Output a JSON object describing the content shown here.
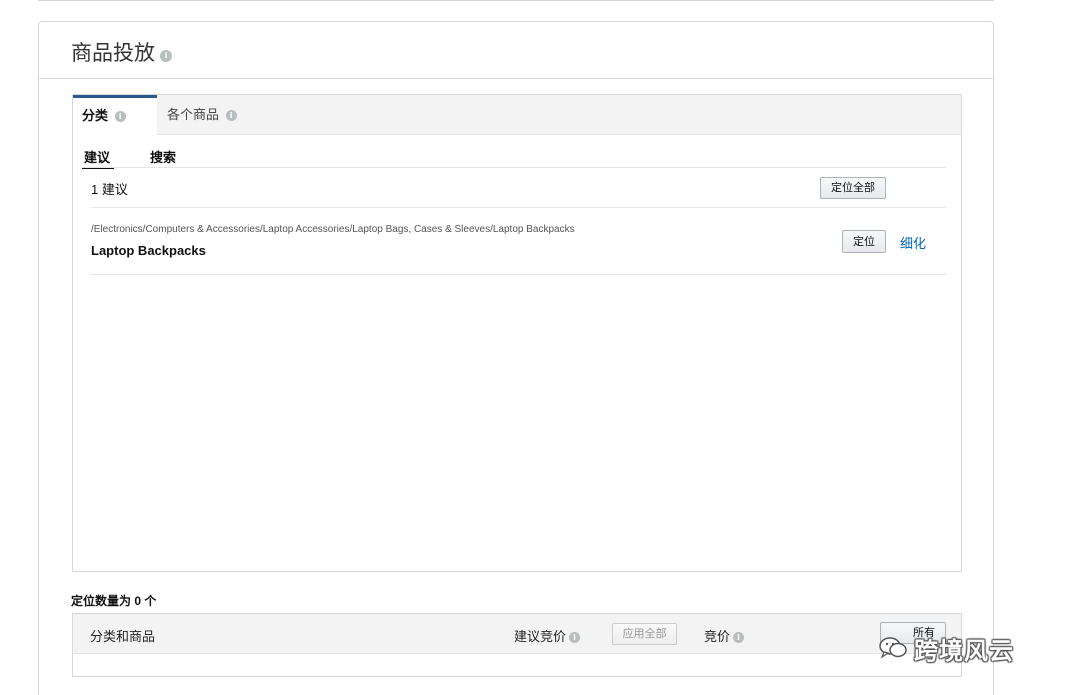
{
  "panel": {
    "title": "商品投放"
  },
  "tabs": [
    {
      "label": "分类"
    },
    {
      "label": "各个商品"
    }
  ],
  "subtabs": [
    {
      "label": "建议"
    },
    {
      "label": "搜索"
    }
  ],
  "suggestions": {
    "count_text": "1 建议",
    "target_all_label": "定位全部",
    "items": [
      {
        "path": "/Electronics/Computers & Accessories/Laptop Accessories/Laptop Bags, Cases & Sleeves/Laptop Backpacks",
        "name": "Laptop Backpacks",
        "target_label": "定位",
        "refine_label": "细化"
      }
    ]
  },
  "targets": {
    "count_text": "定位数量为 0 个",
    "columns": {
      "category_product": "分类和商品",
      "suggested_bid": "建议竞价",
      "apply_all_label": "应用全部",
      "bid": "竞价",
      "remove_all_label": "所有"
    }
  },
  "watermark": {
    "text": "跨境风云"
  },
  "icons": {
    "info": "info-icon",
    "wechat": "wechat-icon"
  },
  "colors": {
    "tab_accent": "#2a5a8c",
    "link": "#0066c0"
  }
}
